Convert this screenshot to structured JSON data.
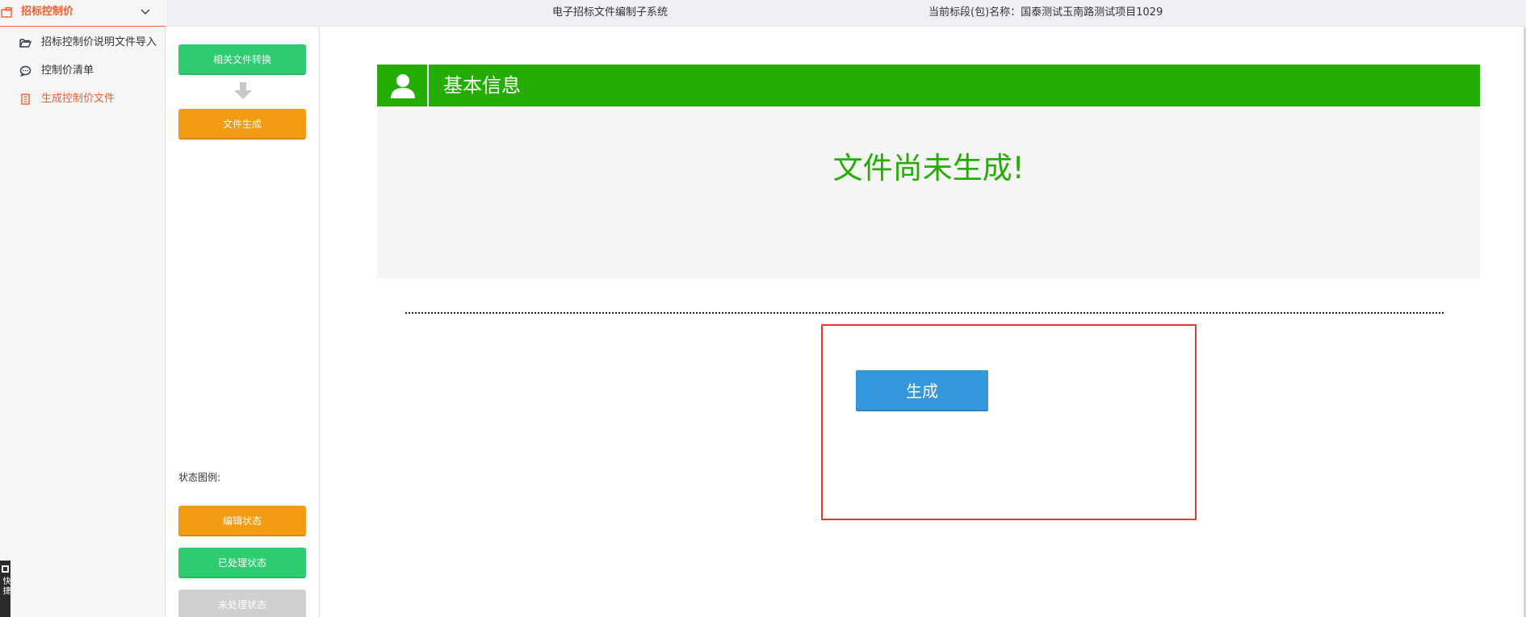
{
  "menu": {
    "header_label": "招标控制价",
    "header_icon": "folder-bid-icon",
    "chevron_icon": "chevron-down-icon",
    "items": [
      {
        "label": "招标控制价说明文件导入",
        "icon": "folder-open-icon",
        "active": false
      },
      {
        "label": "控制价清单",
        "icon": "chat-bubble-icon",
        "active": false
      },
      {
        "label": "生成控制价文件",
        "icon": "document-icon",
        "active": true
      }
    ],
    "side_tab_label": "快捷"
  },
  "topbar": {
    "system_title": "电子招标文件编制子系统",
    "section_label": "当前标段(包)名称：国泰测试玉南路测试项目1029"
  },
  "workflow": {
    "convert_label": "相关文件转换",
    "generate_file_label": "文件生成",
    "legend_title": "状态图例:",
    "legend_editing": "编辑状态",
    "legend_processed": "已处理状态",
    "legend_unprocessed": "未处理状态"
  },
  "main": {
    "info_title": "基本信息",
    "message": "文件尚未生成!",
    "generate_button": "生成"
  },
  "colors": {
    "accent_orange_red": "#f25d2c",
    "green": "#26ad05",
    "button_green": "#2ecc71",
    "button_orange": "#f39c12",
    "button_gray": "#cfcfcf",
    "button_blue": "#3598dc",
    "highlight_red": "#e53935"
  }
}
